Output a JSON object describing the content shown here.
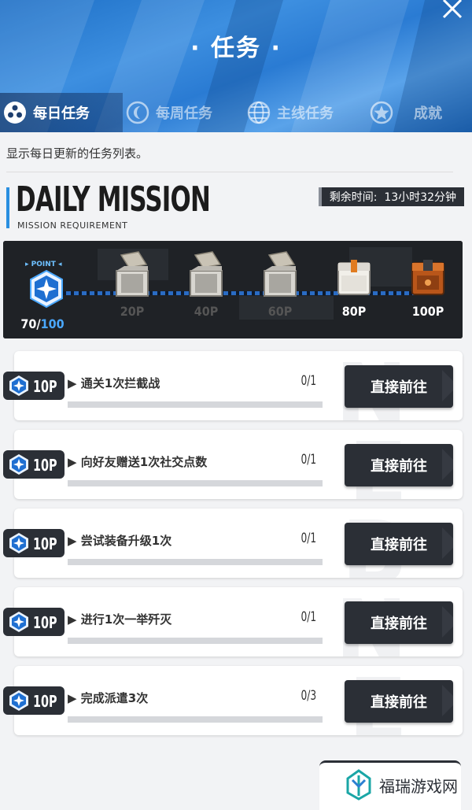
{
  "header": {
    "title": "· 任务 ·"
  },
  "tabs": [
    {
      "label": "每日任务",
      "icon": "dots-icon",
      "active": true
    },
    {
      "label": "每周任务",
      "icon": "moon-icon",
      "active": false
    },
    {
      "label": "主线任务",
      "icon": "globe-icon",
      "active": false
    },
    {
      "label": "成就",
      "icon": "star-icon",
      "active": false
    }
  ],
  "description": "显示每日更新的任务列表。",
  "section": {
    "title": "DAILY MISSION",
    "subtitle": "MISSION REQUIREMENT",
    "timer_label": "剩余时间:",
    "timer_value": "13小时32分钟"
  },
  "points": {
    "tag": "▸ POINT ◂",
    "current": "70",
    "separator": "/",
    "max": "100",
    "rewards": [
      {
        "label": "20P",
        "state": "opened"
      },
      {
        "label": "40P",
        "state": "opened"
      },
      {
        "label": "60P",
        "state": "opened"
      },
      {
        "label": "80P",
        "state": "locked"
      },
      {
        "label": "100P",
        "state": "locked"
      }
    ]
  },
  "missions": [
    {
      "points": "10P",
      "name": "▶ 通关1次拦截战",
      "progress": "0/1",
      "progress_value": 0,
      "button": "直接前往"
    },
    {
      "points": "10P",
      "name": "▶ 向好友赠送1次社交点数",
      "progress": "0/1",
      "progress_value": 0,
      "button": "直接前往"
    },
    {
      "points": "10P",
      "name": "▶ 尝试装备升级1次",
      "progress": "0/1",
      "progress_value": 0,
      "button": "直接前往"
    },
    {
      "points": "10P",
      "name": "▶ 进行1次一举歼灭",
      "progress": "0/1",
      "progress_value": 0,
      "button": "直接前往"
    },
    {
      "points": "10P",
      "name": "▶ 完成派遣3次",
      "progress": "0/3",
      "progress_value": 0,
      "button": "直接前往"
    }
  ],
  "watermark": "福瑞游戏网",
  "colors": {
    "accent": "#2a8fe0",
    "dark": "#2b2f36",
    "header_blue": "#2a7bd3"
  }
}
